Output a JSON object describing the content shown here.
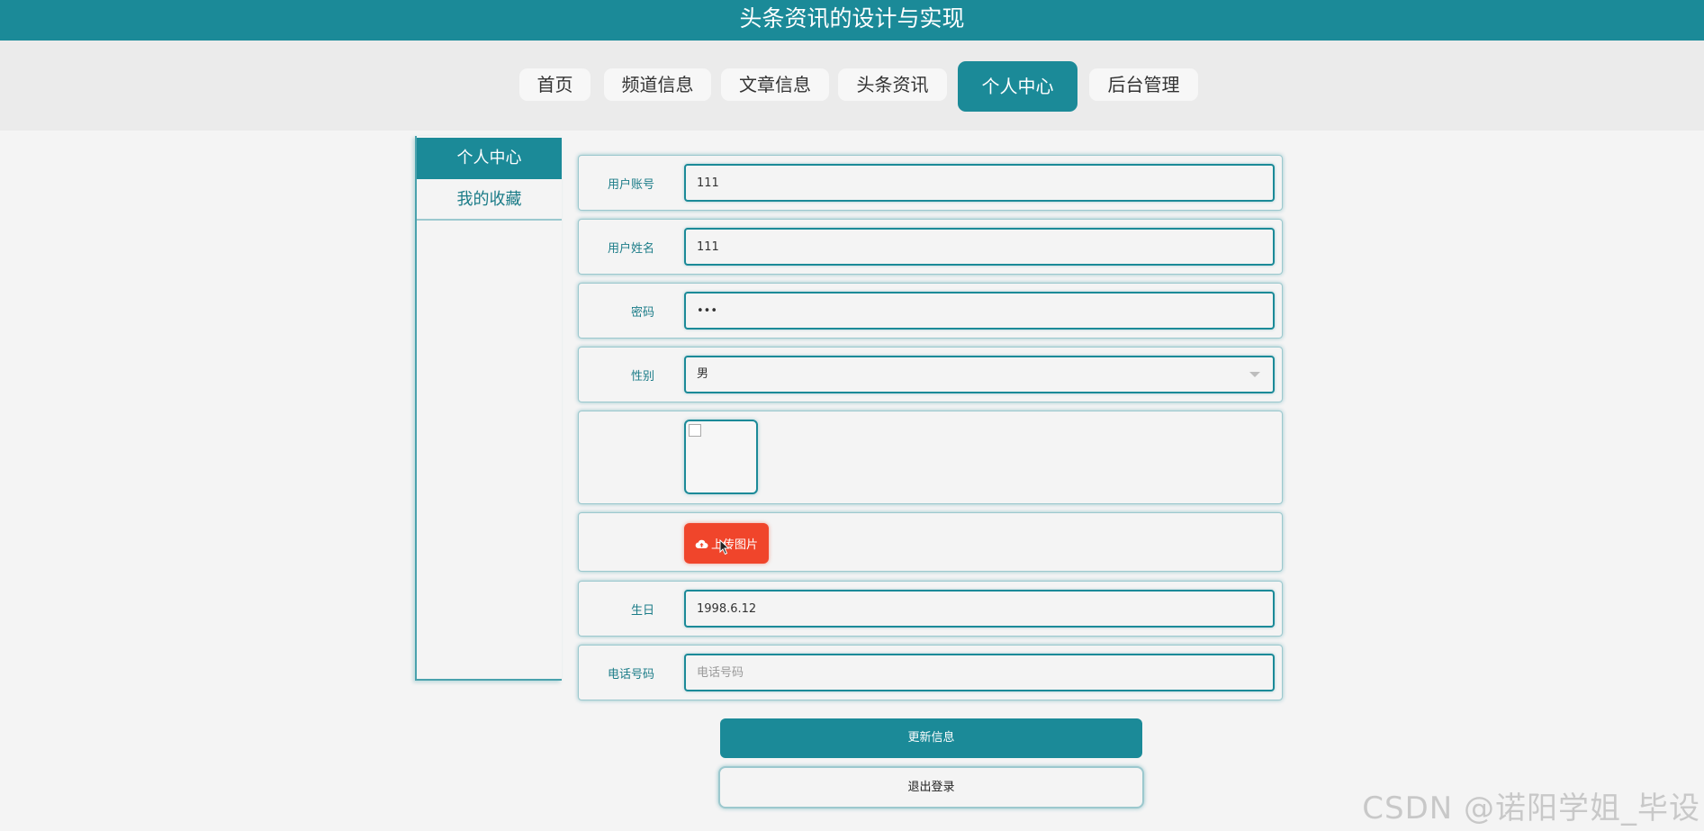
{
  "app": {
    "title": "头条资讯的设计与实现"
  },
  "nav": {
    "items": [
      {
        "label": "首页"
      },
      {
        "label": "频道信息"
      },
      {
        "label": "文章信息"
      },
      {
        "label": "头条资讯"
      },
      {
        "label": "个人中心",
        "active": true
      },
      {
        "label": "后台管理"
      }
    ]
  },
  "sidebar": {
    "items": [
      {
        "label": "个人中心",
        "active": true
      },
      {
        "label": "我的收藏"
      }
    ]
  },
  "form": {
    "account": {
      "label": "用户账号",
      "value": "111"
    },
    "name": {
      "label": "用户姓名",
      "value": "111"
    },
    "password": {
      "label": "密码",
      "value": "•••"
    },
    "gender": {
      "label": "性别",
      "value": "男"
    },
    "upload": {
      "label": "上传图片"
    },
    "birthday": {
      "label": "生日",
      "value": "1998.6.12"
    },
    "phone": {
      "label": "电话号码",
      "value": "",
      "placeholder": "电话号码"
    }
  },
  "actions": {
    "update_label": "更新信息",
    "logout_label": "退出登录"
  },
  "watermark": "CSDN @诺阳学姐_毕设",
  "colors": {
    "brand": "#1b8a98",
    "upload": "#f0452b",
    "background": "#f4f4f4"
  }
}
